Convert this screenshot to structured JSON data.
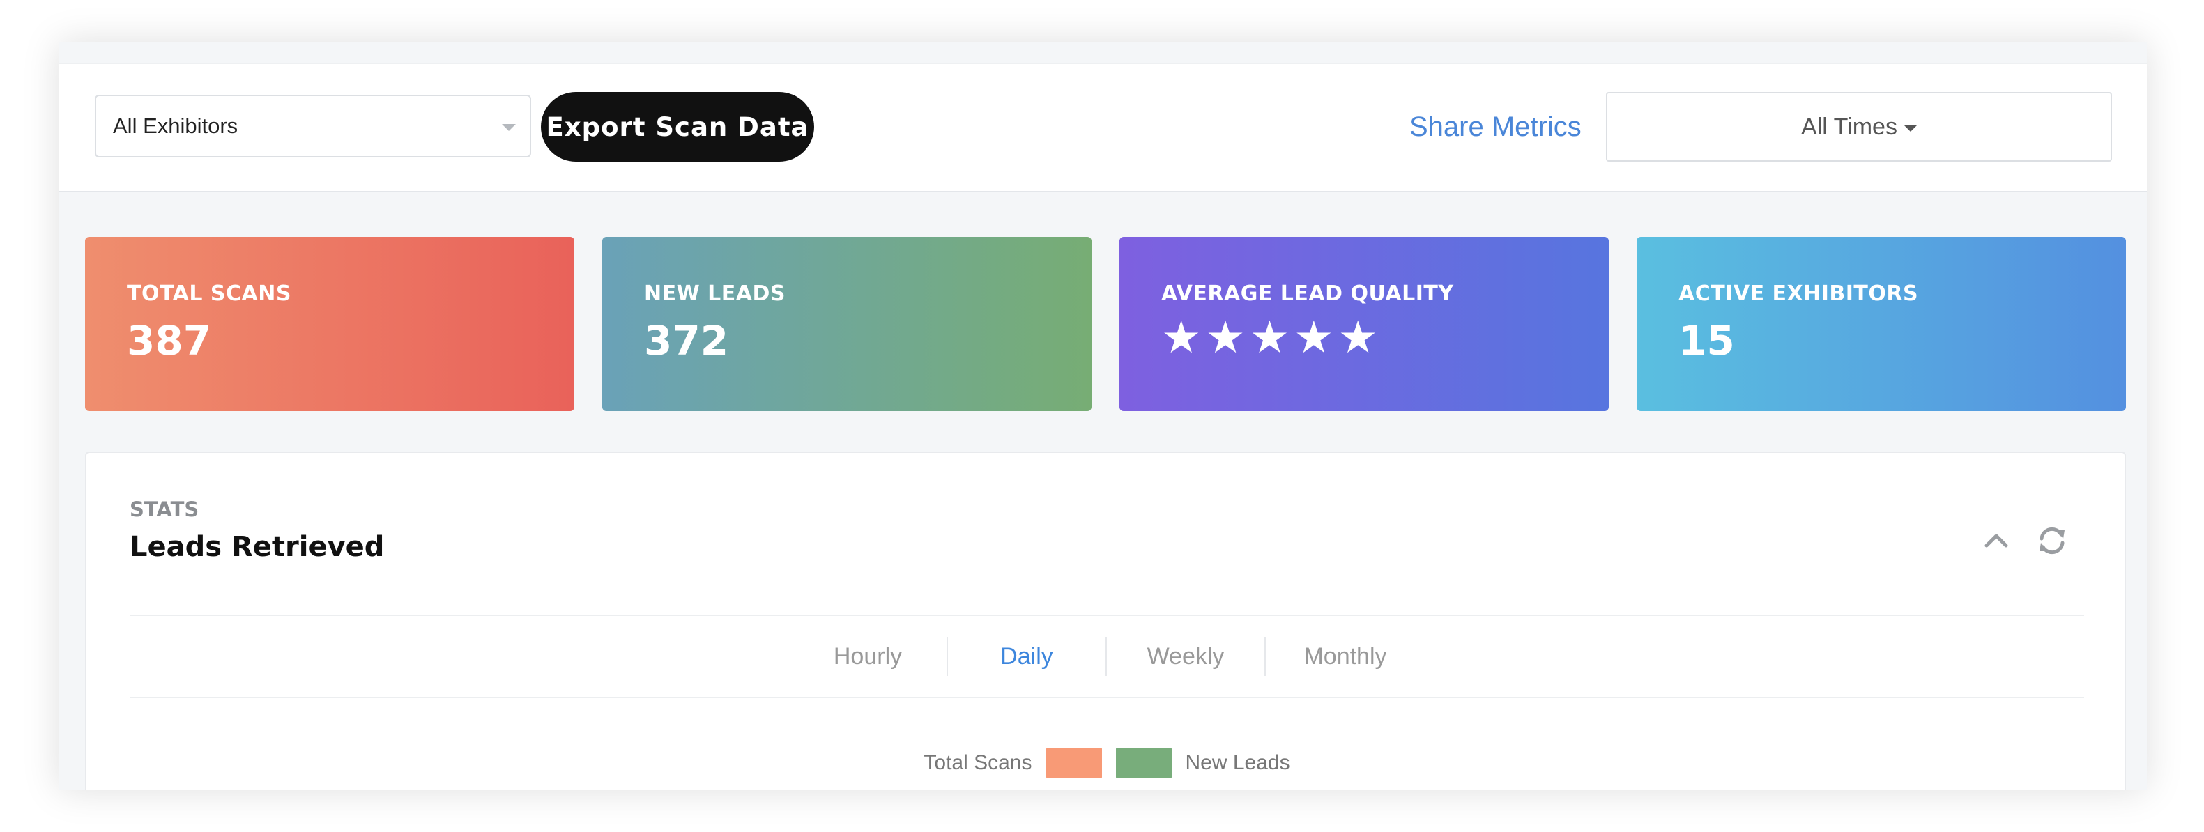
{
  "toolbar": {
    "exhibitor_select": "All Exhibitors",
    "export_label": "Export Scan Data",
    "share_label": "Share Metrics",
    "time_label": "All Times"
  },
  "cards": [
    {
      "label": "TOTAL SCANS",
      "value": "387"
    },
    {
      "label": "NEW LEADS",
      "value": "372"
    },
    {
      "label": "AVERAGE LEAD QUALITY",
      "stars": "★★★★★",
      "rating": 5
    },
    {
      "label": "ACTIVE EXHIBITORS",
      "value": "15"
    }
  ],
  "panel": {
    "subtitle": "STATS",
    "title": "Leads Retrieved",
    "tabs": [
      "Hourly",
      "Daily",
      "Weekly",
      "Monthly"
    ],
    "active_tab": "Daily",
    "legend": [
      {
        "name": "Total Scans",
        "color": "#f89a76"
      },
      {
        "name": "New Leads",
        "color": "#78ad7b"
      }
    ]
  },
  "colors": {
    "accent": "#4a86d8",
    "button_dark": "#111111"
  }
}
